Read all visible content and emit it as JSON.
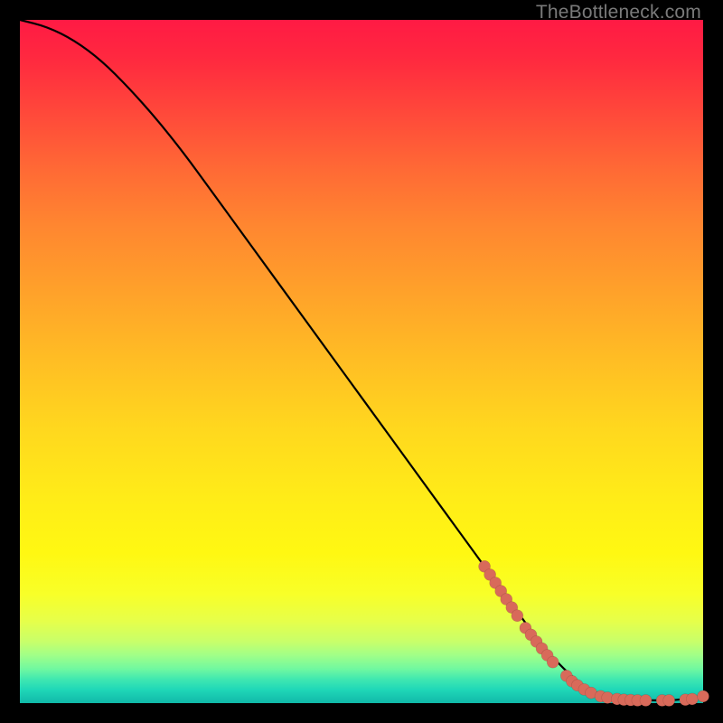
{
  "watermark": "TheBottleneck.com",
  "colors": {
    "frame": "#000000",
    "curve": "#000000",
    "dot": "#d86a5a",
    "gradient_top": "#ff1a44",
    "gradient_bottom": "#10b8a8"
  },
  "chart_data": {
    "type": "line",
    "title": "",
    "xlabel": "",
    "ylabel": "",
    "xlim": [
      0,
      100
    ],
    "ylim": [
      0,
      100
    ],
    "grid": false,
    "legend": false,
    "series": [
      {
        "name": "bottleneck-curve",
        "x": [
          0,
          4,
          8,
          12,
          16,
          20,
          24,
          28,
          32,
          36,
          40,
          44,
          48,
          52,
          56,
          60,
          64,
          68,
          72,
          76,
          80,
          84,
          88,
          92,
          96,
          100
        ],
        "y": [
          100,
          99,
          97,
          94,
          90,
          85.5,
          80.5,
          75,
          69.5,
          64,
          58.5,
          53,
          47.5,
          42,
          36.5,
          31,
          25.5,
          20,
          14.5,
          9,
          4.5,
          1.5,
          0.5,
          0.4,
          0.4,
          1.0
        ]
      }
    ],
    "scatter": {
      "name": "highlighted-points",
      "points": [
        {
          "x": 68.0,
          "y": 20.0
        },
        {
          "x": 68.8,
          "y": 18.8
        },
        {
          "x": 69.6,
          "y": 17.6
        },
        {
          "x": 70.4,
          "y": 16.4
        },
        {
          "x": 71.2,
          "y": 15.2
        },
        {
          "x": 72.0,
          "y": 14.0
        },
        {
          "x": 72.8,
          "y": 12.8
        },
        {
          "x": 74.0,
          "y": 11.0
        },
        {
          "x": 74.8,
          "y": 10.0
        },
        {
          "x": 75.6,
          "y": 9.0
        },
        {
          "x": 76.4,
          "y": 8.0
        },
        {
          "x": 77.2,
          "y": 7.0
        },
        {
          "x": 78.0,
          "y": 6.0
        },
        {
          "x": 80.0,
          "y": 4.0
        },
        {
          "x": 80.8,
          "y": 3.2
        },
        {
          "x": 81.6,
          "y": 2.6
        },
        {
          "x": 82.6,
          "y": 2.0
        },
        {
          "x": 83.6,
          "y": 1.5
        },
        {
          "x": 85.0,
          "y": 1.0
        },
        {
          "x": 86.0,
          "y": 0.8
        },
        {
          "x": 87.4,
          "y": 0.6
        },
        {
          "x": 88.4,
          "y": 0.5
        },
        {
          "x": 89.4,
          "y": 0.45
        },
        {
          "x": 90.4,
          "y": 0.4
        },
        {
          "x": 91.6,
          "y": 0.4
        },
        {
          "x": 94.0,
          "y": 0.4
        },
        {
          "x": 95.0,
          "y": 0.4
        },
        {
          "x": 97.4,
          "y": 0.5
        },
        {
          "x": 98.4,
          "y": 0.6
        },
        {
          "x": 100.0,
          "y": 1.0
        }
      ]
    }
  }
}
